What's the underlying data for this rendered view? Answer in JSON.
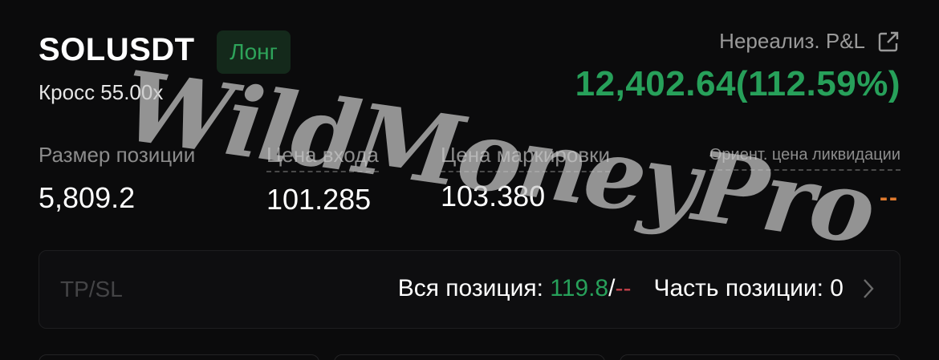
{
  "position": {
    "symbol": "SOLUSDT",
    "side": "Лонг",
    "margin_mode": "Кросс 55.00x"
  },
  "pnl": {
    "label": "Нереализ. P&L",
    "value": "12,402.64(112.59%)",
    "icon": "share-icon"
  },
  "metrics": {
    "size_label": "Размер позиции",
    "size_value": "5,809.2",
    "entry_label": "Цена входа",
    "entry_value": "101.285",
    "mark_label": "Цена маркировки",
    "mark_value": "103.380",
    "liq_label": "Ориент. цена ликвидации",
    "liq_value": "--"
  },
  "tpsl": {
    "label": "TP/SL",
    "full_label": "Вся позиция: ",
    "full_tp": "119.8",
    "separator": "/",
    "full_sl": "--",
    "partial_label": "Часть позиции: 0",
    "chevron_icon": "chevron-right-icon"
  },
  "watermark": "WildMoneyPro",
  "colors": {
    "profit": "#27a05a",
    "loss": "#c8414b",
    "liquidation": "#e07a2e",
    "background": "#0b0b0c"
  }
}
